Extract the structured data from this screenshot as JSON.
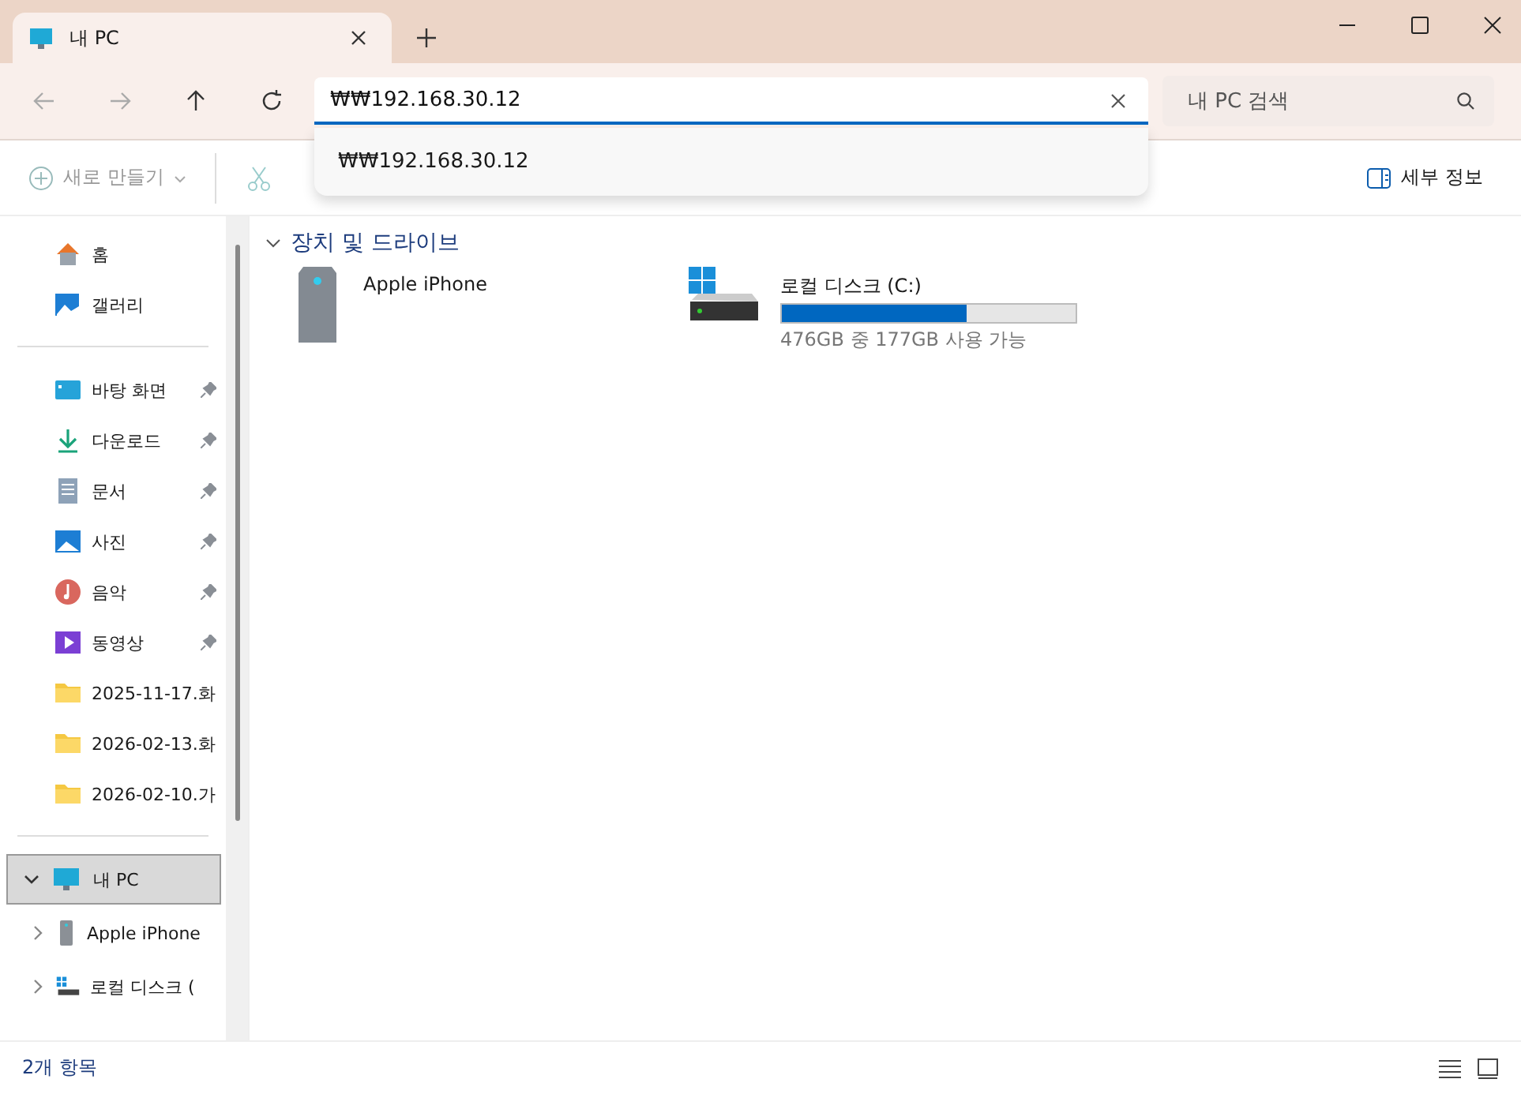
{
  "tab": {
    "title": "내 PC",
    "selected": true
  },
  "address": {
    "value": "₩₩192.168.30.12",
    "suggestions": [
      "₩₩192.168.30.12"
    ]
  },
  "search": {
    "placeholder": "내 PC 검색"
  },
  "toolbar": {
    "new_button": "새로 만들기",
    "details_button": "세부 정보"
  },
  "sidebar": {
    "top": [
      {
        "label": "홈",
        "kind": "home"
      },
      {
        "label": "갤러리",
        "kind": "gallery"
      }
    ],
    "quick_access": [
      {
        "label": "바탕 화면",
        "kind": "desktop",
        "pinned": true
      },
      {
        "label": "다운로드",
        "kind": "download",
        "pinned": true
      },
      {
        "label": "문서",
        "kind": "document",
        "pinned": true
      },
      {
        "label": "사진",
        "kind": "picture",
        "pinned": true
      },
      {
        "label": "음악",
        "kind": "music",
        "pinned": true
      },
      {
        "label": "동영상",
        "kind": "video",
        "pinned": true
      },
      {
        "label": "2025-11-17.화",
        "kind": "folder",
        "pinned": false
      },
      {
        "label": "2026-02-13.화",
        "kind": "folder",
        "pinned": false
      },
      {
        "label": "2026-02-10.가",
        "kind": "folder",
        "pinned": false
      }
    ],
    "tree": [
      {
        "label": "내 PC",
        "kind": "pc",
        "expanded": true,
        "selected": true,
        "children": [
          {
            "label": "Apple iPhone",
            "kind": "device",
            "expanded": false,
            "selected": false
          },
          {
            "label": "로컬 디스크 (",
            "kind": "drive",
            "expanded": false,
            "selected": false
          }
        ]
      }
    ]
  },
  "content": {
    "group": {
      "title": "장치 및 드라이브",
      "expanded": true
    },
    "items": [
      {
        "kind": "device",
        "name": "Apple iPhone"
      },
      {
        "kind": "drive",
        "name": "로컬 디스크 (C:)",
        "level": 0.63,
        "caption": "476GB 중 177GB 사용 가능"
      }
    ]
  },
  "status_bar": {
    "count": "2개 항목"
  }
}
